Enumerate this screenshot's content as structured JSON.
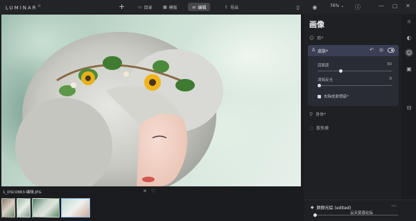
{
  "app": {
    "logo": "LUMINAR",
    "logo_sup": "AI"
  },
  "toolbar": {
    "tabs": [
      {
        "label": "目录",
        "icon": "folder-icon"
      },
      {
        "label": "模板",
        "icon": "grid-icon"
      },
      {
        "label": "编辑",
        "icon": "sliders-icon"
      },
      {
        "label": "导出",
        "icon": "export-icon"
      }
    ],
    "zoom": "76%"
  },
  "image": {
    "filename": "1_DSC0863-编辑.JPG"
  },
  "panel": {
    "title": "画像",
    "sections": {
      "top": "脸*",
      "skin": {
        "title": "皮肤*",
        "sliders": [
          {
            "label": "润面度",
            "value": "30",
            "fraction": 0.3
          },
          {
            "label": "消除反光",
            "value": "0",
            "fraction": 0.0
          }
        ],
        "checkbox": "去除皮肤瑕疵*"
      },
      "body": "身体*",
      "bokeh": "散焦模"
    }
  },
  "preset": {
    "name": "颜颜光绘 (edited)",
    "amount_fraction": 0.0
  },
  "watermark": "云天资源论坛"
}
